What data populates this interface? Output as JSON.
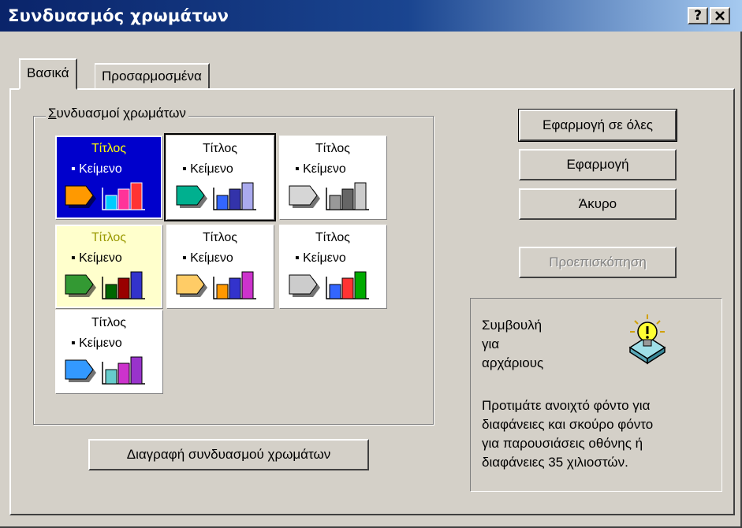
{
  "window": {
    "title": "Συνδυασμός χρωμάτων",
    "help_label": "?",
    "close_label": "✕"
  },
  "tabs": [
    {
      "label": "Βασικά"
    },
    {
      "label": "Προσαρμοσμένα"
    }
  ],
  "schemes_group": {
    "label": "Συνδυασμοί χρωμάτων"
  },
  "schemes": [
    {
      "title": "Τίτλος",
      "text": "Κείμενο",
      "bg": "#0000cc",
      "title_color": "#ffff00",
      "text_color": "#ffffff",
      "arrow": "#ff9900",
      "bars": [
        "#00ccff",
        "#ff3399",
        "#ff3333"
      ]
    },
    {
      "title": "Τίτλος",
      "text": "Κείμενο",
      "bg": "#ffffff",
      "title_color": "#000000",
      "text_color": "#000000",
      "arrow": "#00b08f",
      "bars": [
        "#3366ff",
        "#3333aa",
        "#aaaaee"
      ],
      "selected": true
    },
    {
      "title": "Τίτλος",
      "text": "Κείμενο",
      "bg": "#ffffff",
      "title_color": "#000000",
      "text_color": "#000000",
      "arrow": "#d6d6d6",
      "bars": [
        "#999999",
        "#666666",
        "#cccccc"
      ]
    },
    {
      "title": "Τίτλος",
      "text": "Κείμενο",
      "bg": "#ffffcc",
      "title_color": "#999900",
      "text_color": "#000000",
      "arrow": "#339933",
      "bars": [
        "#006600",
        "#990000",
        "#3333cc"
      ]
    },
    {
      "title": "Τίτλος",
      "text": "Κείμενο",
      "bg": "#ffffff",
      "title_color": "#000000",
      "text_color": "#000000",
      "arrow": "#ffcc66",
      "bars": [
        "#ff9900",
        "#3333cc",
        "#cc33cc"
      ]
    },
    {
      "title": "Τίτλος",
      "text": "Κείμενο",
      "bg": "#ffffff",
      "title_color": "#000000",
      "text_color": "#000000",
      "arrow": "#cccccc",
      "bars": [
        "#3366ff",
        "#ff3333",
        "#00aa00"
      ]
    },
    {
      "title": "Τίτλος",
      "text": "Κείμενο",
      "bg": "#ffffff",
      "title_color": "#000000",
      "text_color": "#000000",
      "arrow": "#3399ff",
      "bars": [
        "#66cccc",
        "#cc33cc",
        "#9933cc"
      ]
    }
  ],
  "buttons": {
    "apply_all": "Εφαρμογή σε όλες",
    "apply": "Εφαρμογή",
    "cancel": "Άκυρο",
    "preview": "Προεπισκόπηση",
    "delete_scheme": "Διαγραφή συνδυασμού χρωμάτων"
  },
  "tip": {
    "heading_lines": [
      "Συμβουλή",
      "για",
      "αρχάριους"
    ],
    "body_lines": [
      "Προτιμάτε ανοιχτό φόντο για",
      "διαφάνειες και σκούρο φόντο",
      "για παρουσιάσεις οθόνης ή",
      "διαφάνειες 35 χιλιοστών."
    ],
    "icon": "lightbulb-icon"
  }
}
